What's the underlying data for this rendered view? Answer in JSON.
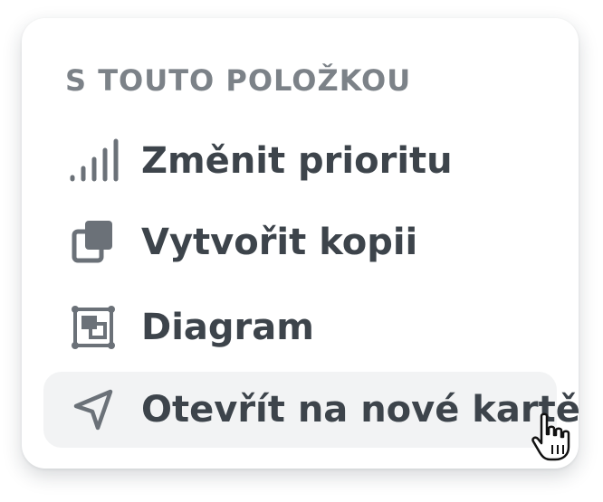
{
  "menu": {
    "heading": "S TOUTO POLOŽKOU",
    "items": [
      {
        "label": "Změnit prioritu",
        "icon": "signal-bars-icon"
      },
      {
        "label": "Vytvořit kopii",
        "icon": "copy-icon"
      },
      {
        "label": "Diagram",
        "icon": "diagram-icon"
      },
      {
        "label": "Otevřít na nové kartě",
        "icon": "navigation-arrow-icon",
        "hovered": true
      }
    ]
  },
  "colors": {
    "heading": "#7c8288",
    "label": "#3d444b",
    "icon": "#6b7178",
    "hover_background": "#f2f3f4"
  },
  "cursor": {
    "icon": "hand-pointer-cursor-icon"
  }
}
